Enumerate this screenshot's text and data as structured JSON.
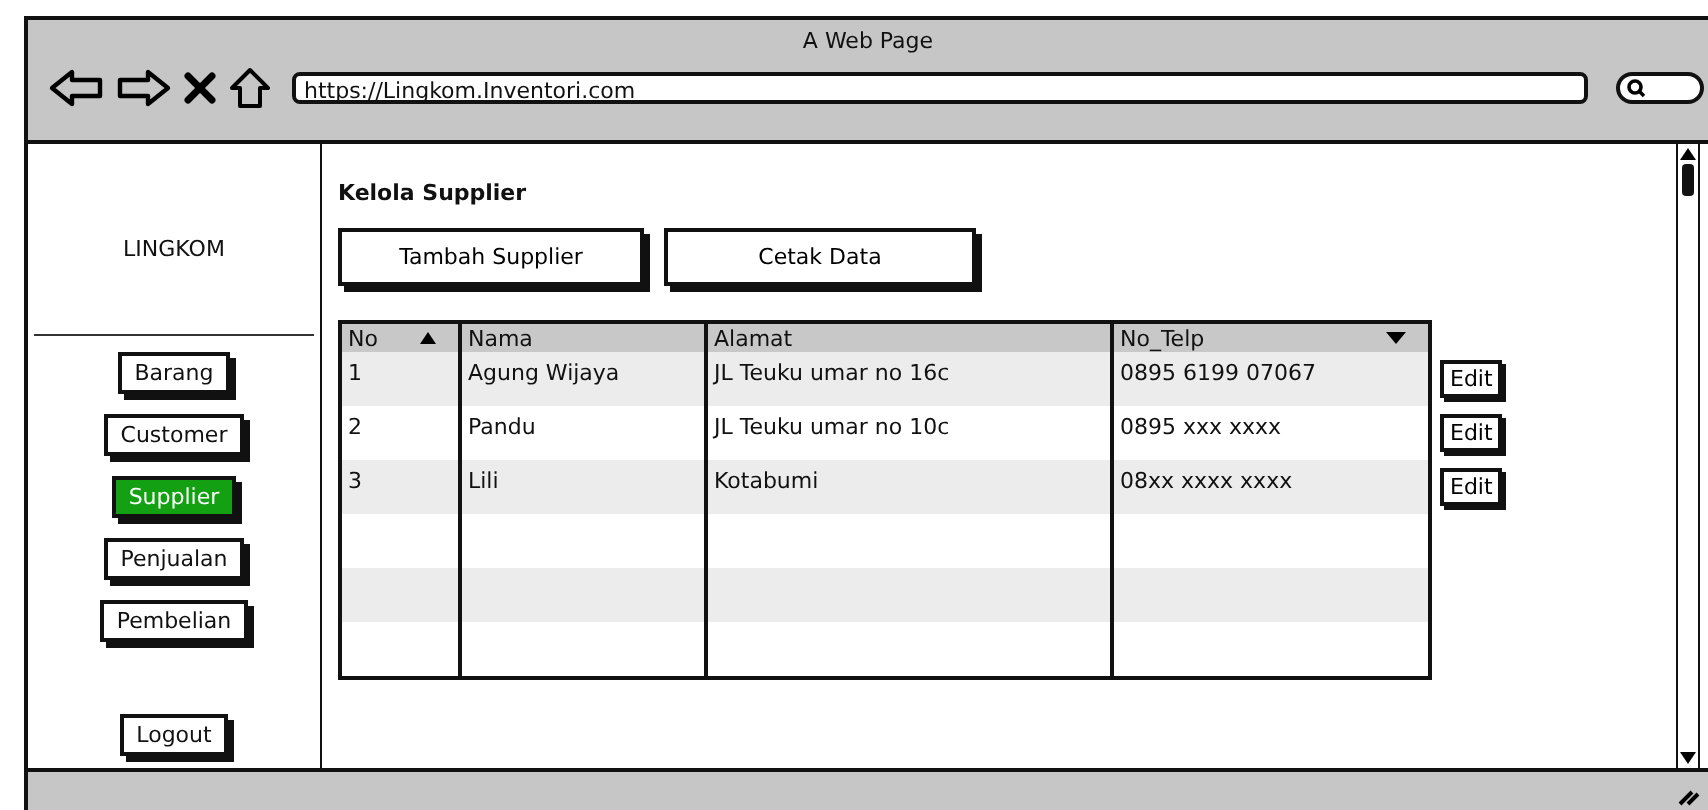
{
  "window": {
    "title": "A Web Page",
    "url": "https://Lingkom.Inventori.com"
  },
  "sidebar": {
    "brand": "LINGKOM",
    "items": [
      {
        "label": "Barang",
        "selected": false
      },
      {
        "label": "Customer",
        "selected": false
      },
      {
        "label": "Supplier",
        "selected": true
      },
      {
        "label": "Penjualan",
        "selected": false
      },
      {
        "label": "Pembelian",
        "selected": false
      }
    ],
    "logout": "Logout"
  },
  "page": {
    "heading": "Kelola Supplier",
    "buttons": [
      "Tambah Supplier",
      "Cetak Data"
    ]
  },
  "table": {
    "columns": [
      {
        "label": "No",
        "sorted": true,
        "descending": false
      },
      {
        "label": "Nama",
        "sorted": false
      },
      {
        "label": "Alamat",
        "sorted": false
      },
      {
        "label": "No_Telp",
        "sorted": true,
        "descending": true
      }
    ],
    "rows": [
      {
        "cells": [
          "1",
          "Agung Wijaya",
          "JL Teuku umar no 16c",
          "0895 6199 07067"
        ],
        "action": "Edit"
      },
      {
        "cells": [
          "2",
          "Pandu",
          "JL Teuku umar no 10c",
          "0895 xxx xxxx"
        ],
        "action": "Edit"
      },
      {
        "cells": [
          "3",
          "Lili",
          "Kotabumi",
          "08xx xxxx xxxx"
        ],
        "action": "Edit"
      }
    ]
  }
}
